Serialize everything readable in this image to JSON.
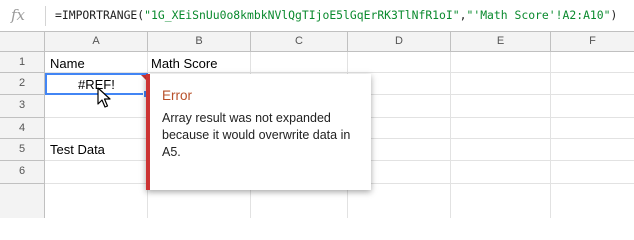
{
  "formula_bar": {
    "fx_label": "fx",
    "formula_fn": "=IMPORTRANGE(",
    "formula_arg1": "\"1G_XEiSnUu0o8kmbkNVlQgTIjoE5lGqErRK3TlNfR1oI\"",
    "formula_comma": ",",
    "formula_arg2": "\"'Math Score'!A2:A10\"",
    "formula_close": ")"
  },
  "columns": [
    "A",
    "B",
    "C",
    "D",
    "E",
    "F"
  ],
  "rows": [
    "1",
    "2",
    "3",
    "4",
    "5",
    "6"
  ],
  "cells": {
    "a1": "Name",
    "b1": "Math Score",
    "a2": "#REF!",
    "a5": "Test Data"
  },
  "error_popup": {
    "title": "Error",
    "message": "Array result was not expanded because it would overwrite data in A5."
  },
  "colors": {
    "selection": "#4285f4",
    "error": "#cc3333",
    "error_title": "#b8502a"
  }
}
